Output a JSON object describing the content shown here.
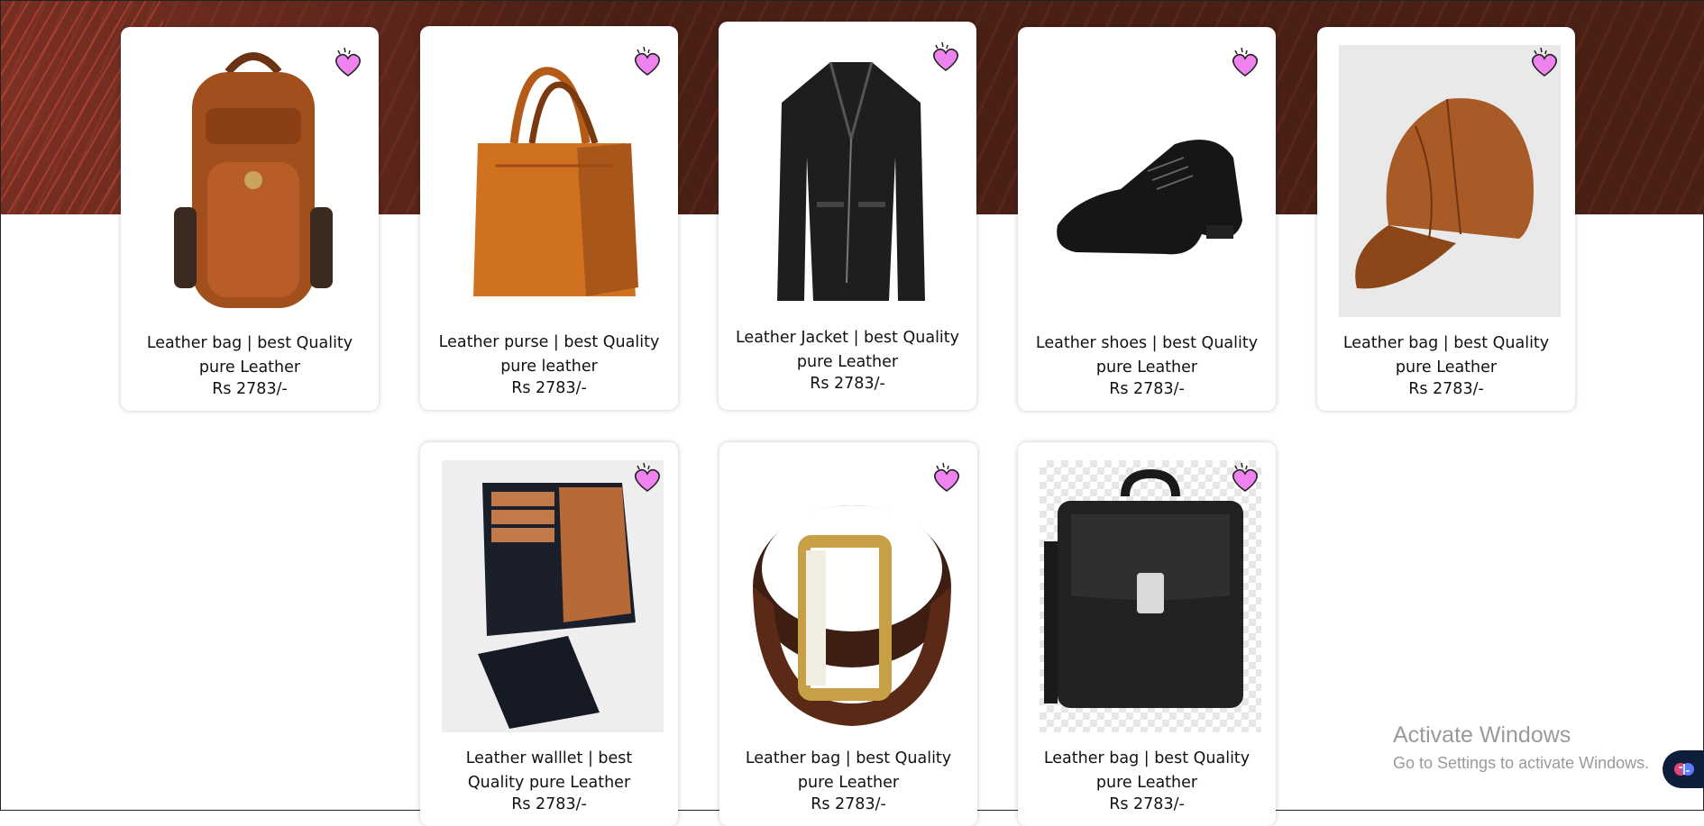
{
  "products": [
    {
      "title": "Leather bag | best Quality pure Leather",
      "price": "Rs 2783/-",
      "icon": "backpack"
    },
    {
      "title": "Leather purse | best Quality pure leather",
      "price": "Rs 2783/-",
      "icon": "tote"
    },
    {
      "title": "Leather Jacket | best Quality pure Leather",
      "price": "Rs 2783/-",
      "icon": "jacket"
    },
    {
      "title": "Leather shoes | best Quality pure Leather",
      "price": "Rs 2783/-",
      "icon": "shoe"
    },
    {
      "title": "Leather bag | best Quality pure Leather",
      "price": "Rs 2783/-",
      "icon": "cap"
    },
    {
      "title": "Leather walllet | best Quality pure Leather",
      "price": "Rs 2783/-",
      "icon": "wallet"
    },
    {
      "title": "Leather bag | best Quality pure Leather",
      "price": "Rs 2783/-",
      "icon": "belt"
    },
    {
      "title": "Leather bag | best Quality pure Leather",
      "price": "Rs 2783/-",
      "icon": "briefcase"
    }
  ],
  "watermark": {
    "line1": "Activate Windows",
    "line2": "Go to Settings to activate Windows."
  },
  "colors": {
    "heart": "#ee82ee",
    "hero": "#4a2016"
  }
}
